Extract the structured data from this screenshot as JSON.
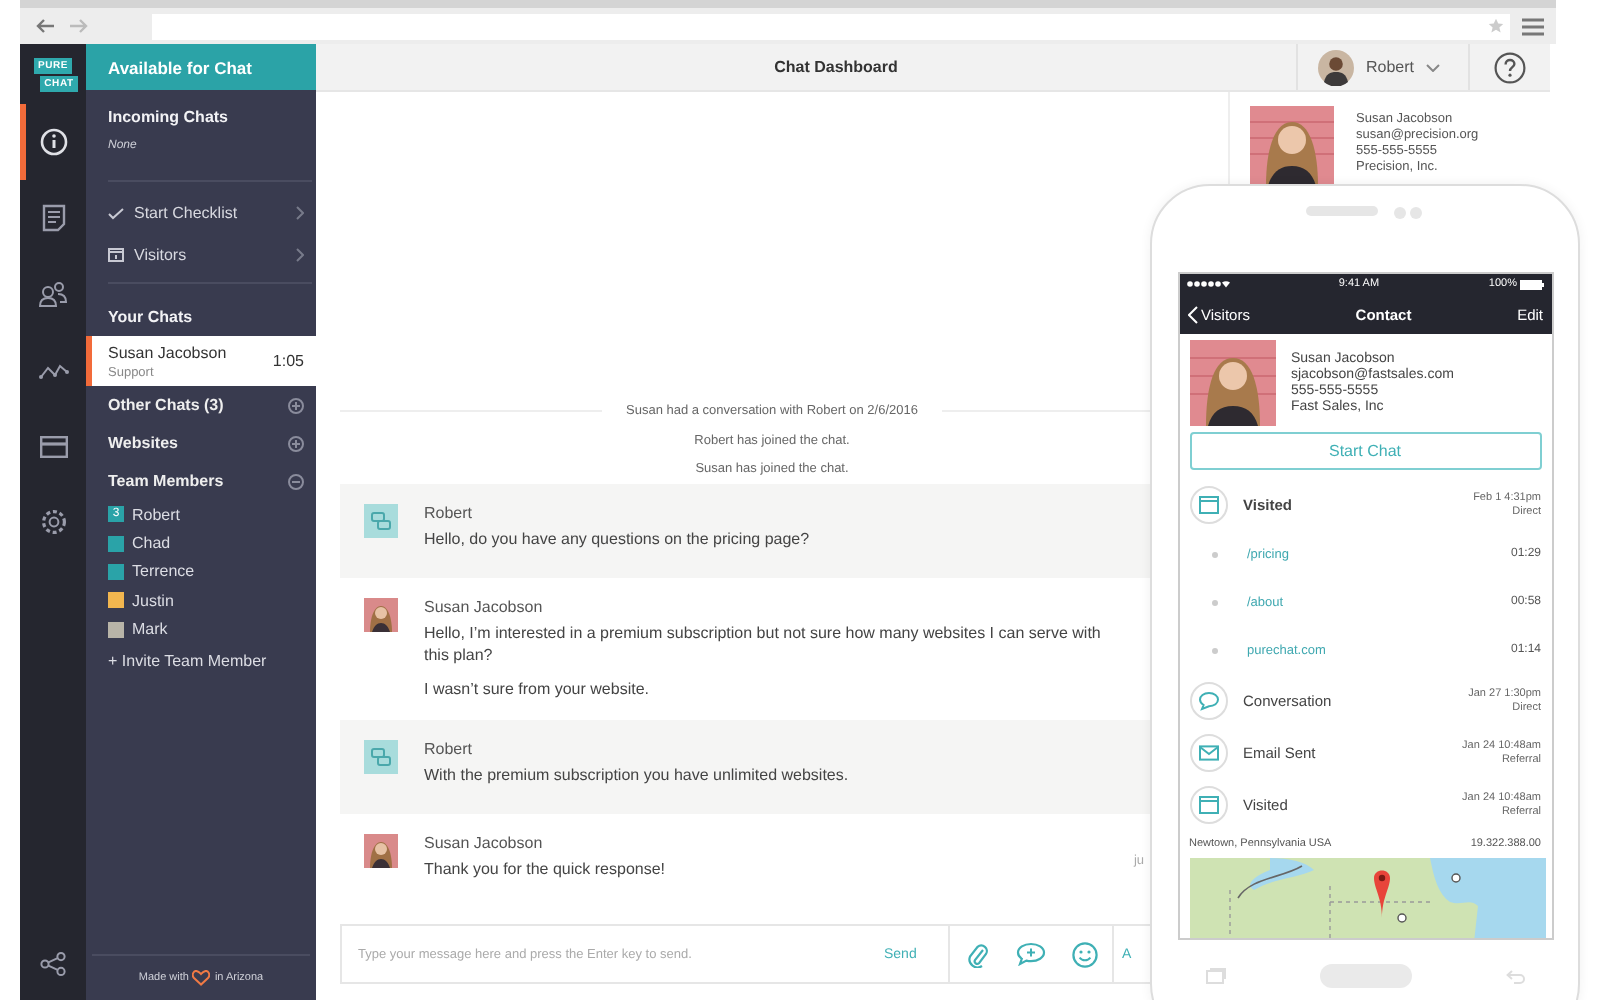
{
  "rail": {
    "logo": [
      "PURE",
      "CHAT"
    ],
    "items": [
      {
        "kind": "info",
        "selected": true
      },
      {
        "kind": "notes",
        "selected": false
      },
      {
        "kind": "people",
        "selected": false
      },
      {
        "kind": "analytics",
        "selected": false
      },
      {
        "kind": "card",
        "selected": false
      },
      {
        "kind": "settings",
        "selected": false
      }
    ]
  },
  "sidebar": {
    "status": "Available for Chat",
    "incoming": {
      "title": "Incoming Chats",
      "value": "None"
    },
    "links": [
      {
        "kind": "checklist",
        "label": "Start Checklist"
      },
      {
        "kind": "visitors",
        "label": "Visitors"
      }
    ],
    "your_chats": {
      "title": "Your Chats",
      "items": [
        {
          "name": "Susan Jacobson",
          "department": "Support",
          "duration": "1:05",
          "selected": true
        }
      ]
    },
    "sections": [
      {
        "label": "Other Chats (3)",
        "expanded": false
      },
      {
        "label": "Websites",
        "expanded": false
      },
      {
        "label": "Team Members",
        "expanded": true
      }
    ],
    "team": [
      {
        "name": "Robert",
        "color": "#2aa3a8",
        "count": "3"
      },
      {
        "name": "Chad",
        "color": "#2aa3a8"
      },
      {
        "name": "Terrence",
        "color": "#2aa3a8"
      },
      {
        "name": "Justin",
        "color": "#f2b64f"
      },
      {
        "name": "Mark",
        "color": "#b8b4a8"
      }
    ],
    "invite": "+ Invite Team Member",
    "footer": {
      "before": "Made with",
      "after": "in Arizona"
    }
  },
  "header": {
    "title": "Chat Dashboard",
    "user": "Robert"
  },
  "chat": {
    "events": [
      "Susan had a conversation with Robert on 2/6/2016",
      "Robert has joined the chat.",
      "Susan has joined the chat."
    ],
    "messages": [
      {
        "kind": "agent",
        "author": "Robert",
        "lines": [
          "Hello, do you have any questions on the pricing page?"
        ]
      },
      {
        "kind": "visitor",
        "author": "Susan Jacobson",
        "lines": [
          "Hello, I’m interested in a premium subscription but not sure how many websites I can serve with this plan?",
          "I wasn’t sure from your website."
        ]
      },
      {
        "kind": "agent",
        "author": "Robert",
        "lines": [
          "With the premium subscription you have unlimited websites."
        ]
      },
      {
        "kind": "visitor",
        "author": "Susan Jacobson",
        "lines": [
          "Thank you for the quick response!"
        ],
        "time": "ju"
      }
    ],
    "input": {
      "placeholder": "Type your message here and press the Enter key to send.",
      "send": "Send",
      "more": "A"
    }
  },
  "contact": {
    "name": "Susan Jacobson",
    "email": "susan@precision.org",
    "phone": "555-555-5555",
    "company": "Precision, Inc."
  },
  "phone": {
    "status": {
      "time": "9:41 AM",
      "battery": "100%"
    },
    "nav": {
      "back": "Visitors",
      "title": "Contact",
      "action": "Edit"
    },
    "contact": {
      "name": "Susan Jacobson",
      "email": "sjacobson@fastsales.com",
      "phone": "555-555-5555",
      "company": "Fast Sales, Inc"
    },
    "button": "Start Chat",
    "timeline": [
      {
        "kind": "visit",
        "label": "Visited",
        "date": "Feb 1 4:31pm",
        "source": "Direct",
        "expanded": true,
        "children": [
          {
            "label": "/pricing",
            "duration": "01:29"
          },
          {
            "label": "/about",
            "duration": "00:58"
          },
          {
            "label": "purechat.com",
            "duration": "01:14"
          }
        ]
      },
      {
        "kind": "conversation",
        "label": "Conversation",
        "date": "Jan 27 1:30pm",
        "source": "Direct"
      },
      {
        "kind": "email",
        "label": "Email Sent",
        "date": "Jan 24 10:48am",
        "source": "Referral"
      },
      {
        "kind": "visit",
        "label": "Visited",
        "date": "Jan 24 10:48am",
        "source": "Referral",
        "expanded": false
      }
    ],
    "location": {
      "place": "Newtown, Pennsylvania USA",
      "ip": "19.322.388.00"
    }
  }
}
